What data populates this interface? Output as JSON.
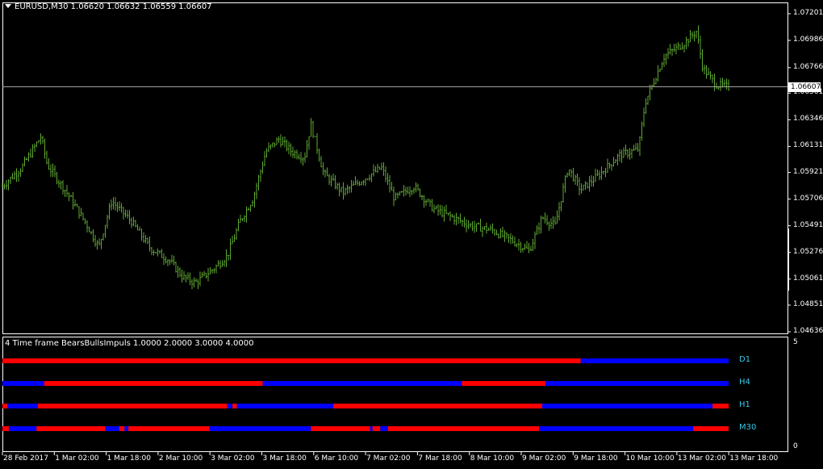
{
  "window": {
    "symbol_header": "EURUSD,M30  1.06620 1.06632 1.06559 1.06607",
    "indicator_header": "4 Time frame BearsBullsImpuls 1.0000 2.0000 3.0000 4.0000"
  },
  "colors": {
    "background": "#000000",
    "bars": "#5fa832",
    "axis": "#ffffff",
    "bear": "#ff0000",
    "bull": "#0000ff",
    "timeframe_label": "#38c8e8"
  },
  "current_price": "1.06607",
  "indicator_scale": {
    "top": "5",
    "bottom": "0"
  },
  "chart_data": [
    {
      "type": "ohlc",
      "symbol": "EURUSD",
      "timeframe": "M30",
      "y_ticks": [
        "1.07201",
        "1.06986",
        "1.06766",
        "1.06561",
        "1.06346",
        "1.06131",
        "1.05921",
        "1.05706",
        "1.05491",
        "1.05276",
        "1.05061",
        "1.04851",
        "1.04636"
      ],
      "ylim": [
        1.04636,
        1.07201
      ],
      "x_labels": [
        "28 Feb 2017",
        "1 Mar 02:00",
        "1 Mar 18:00",
        "2 Mar 10:00",
        "3 Mar 02:00",
        "3 Mar 18:00",
        "6 Mar 10:00",
        "7 Mar 02:00",
        "7 Mar 18:00",
        "8 Mar 10:00",
        "9 Mar 02:00",
        "9 Mar 18:00",
        "10 Mar 10:00",
        "13 Mar 02:00",
        "13 Mar 18:00"
      ],
      "close_path": [
        [
          0,
          1.0581
        ],
        [
          3,
          1.0596
        ],
        [
          6,
          1.0621
        ],
        [
          7,
          1.0598
        ],
        [
          10,
          1.0576
        ],
        [
          13,
          1.0551
        ],
        [
          15,
          1.0532
        ],
        [
          17,
          1.0569
        ],
        [
          20,
          1.0553
        ],
        [
          23,
          1.0531
        ],
        [
          26,
          1.0521
        ],
        [
          28,
          1.0508
        ],
        [
          30,
          1.0503
        ],
        [
          33,
          1.0515
        ],
        [
          35,
          1.0525
        ],
        [
          37,
          1.0553
        ],
        [
          39,
          1.0571
        ],
        [
          41,
          1.0609
        ],
        [
          43,
          1.0619
        ],
        [
          45,
          1.0609
        ],
        [
          47,
          1.0604
        ],
        [
          48,
          1.0631
        ],
        [
          50,
          1.0591
        ],
        [
          53,
          1.0576
        ],
        [
          56,
          1.0586
        ],
        [
          59,
          1.0596
        ],
        [
          61,
          1.0571
        ],
        [
          64,
          1.0581
        ],
        [
          67,
          1.0563
        ],
        [
          70,
          1.0556
        ],
        [
          73,
          1.0549
        ],
        [
          76,
          1.0546
        ],
        [
          79,
          1.0538
        ],
        [
          82,
          1.0529
        ],
        [
          84,
          1.0556
        ],
        [
          86,
          1.0549
        ],
        [
          88,
          1.0596
        ],
        [
          90,
          1.0578
        ],
        [
          93,
          1.0591
        ],
        [
          96,
          1.0606
        ],
        [
          99,
          1.0611
        ],
        [
          100,
          1.0648
        ],
        [
          101,
          1.0661
        ],
        [
          103,
          1.0686
        ],
        [
          106,
          1.0696
        ],
        [
          108,
          1.0706
        ],
        [
          109,
          1.0676
        ],
        [
          111,
          1.0663
        ],
        [
          113,
          1.0661
        ]
      ]
    },
    {
      "type": "heatmap",
      "title": "BearsBullsImpuls",
      "rows": [
        {
          "name": "D1",
          "segments": [
            {
              "from": 0,
              "to": 90,
              "value": "bear"
            },
            {
              "from": 90,
              "to": 113,
              "value": "bull"
            }
          ]
        },
        {
          "name": "H4",
          "segments": [
            {
              "from": 0,
              "to": 6.5,
              "value": "bull"
            },
            {
              "from": 6.5,
              "to": 40.5,
              "value": "bear"
            },
            {
              "from": 40.5,
              "to": 71.5,
              "value": "bull"
            },
            {
              "from": 71.5,
              "to": 84.5,
              "value": "bear"
            },
            {
              "from": 84.5,
              "to": 113,
              "value": "bull"
            }
          ]
        },
        {
          "name": "H1",
          "segments": [
            {
              "from": 0,
              "to": 0.8,
              "value": "bear"
            },
            {
              "from": 0.8,
              "to": 5.5,
              "value": "bull"
            },
            {
              "from": 5.5,
              "to": 35,
              "value": "bear"
            },
            {
              "from": 35,
              "to": 35.8,
              "value": "bull"
            },
            {
              "from": 35.8,
              "to": 36.5,
              "value": "bear"
            },
            {
              "from": 36.5,
              "to": 51.5,
              "value": "bull"
            },
            {
              "from": 51.5,
              "to": 84,
              "value": "bear"
            },
            {
              "from": 84,
              "to": 110.5,
              "value": "bull"
            },
            {
              "from": 110.5,
              "to": 113,
              "value": "bear"
            }
          ]
        },
        {
          "name": "M30",
          "segments": [
            {
              "from": 0,
              "to": 1,
              "value": "bear"
            },
            {
              "from": 1,
              "to": 5.3,
              "value": "bull"
            },
            {
              "from": 5.3,
              "to": 16,
              "value": "bear"
            },
            {
              "from": 16,
              "to": 18.2,
              "value": "bull"
            },
            {
              "from": 18.2,
              "to": 19,
              "value": "bear"
            },
            {
              "from": 19,
              "to": 19.6,
              "value": "bull"
            },
            {
              "from": 19.6,
              "to": 32.2,
              "value": "bear"
            },
            {
              "from": 32.2,
              "to": 48,
              "value": "bull"
            },
            {
              "from": 48,
              "to": 57.2,
              "value": "bear"
            },
            {
              "from": 57.2,
              "to": 57.6,
              "value": "bull"
            },
            {
              "from": 57.6,
              "to": 58.8,
              "value": "bear"
            },
            {
              "from": 58.8,
              "to": 60,
              "value": "bull"
            },
            {
              "from": 60,
              "to": 83.5,
              "value": "bear"
            },
            {
              "from": 83.5,
              "to": 107.5,
              "value": "bull"
            },
            {
              "from": 107.5,
              "to": 113,
              "value": "bear"
            }
          ]
        }
      ]
    }
  ]
}
